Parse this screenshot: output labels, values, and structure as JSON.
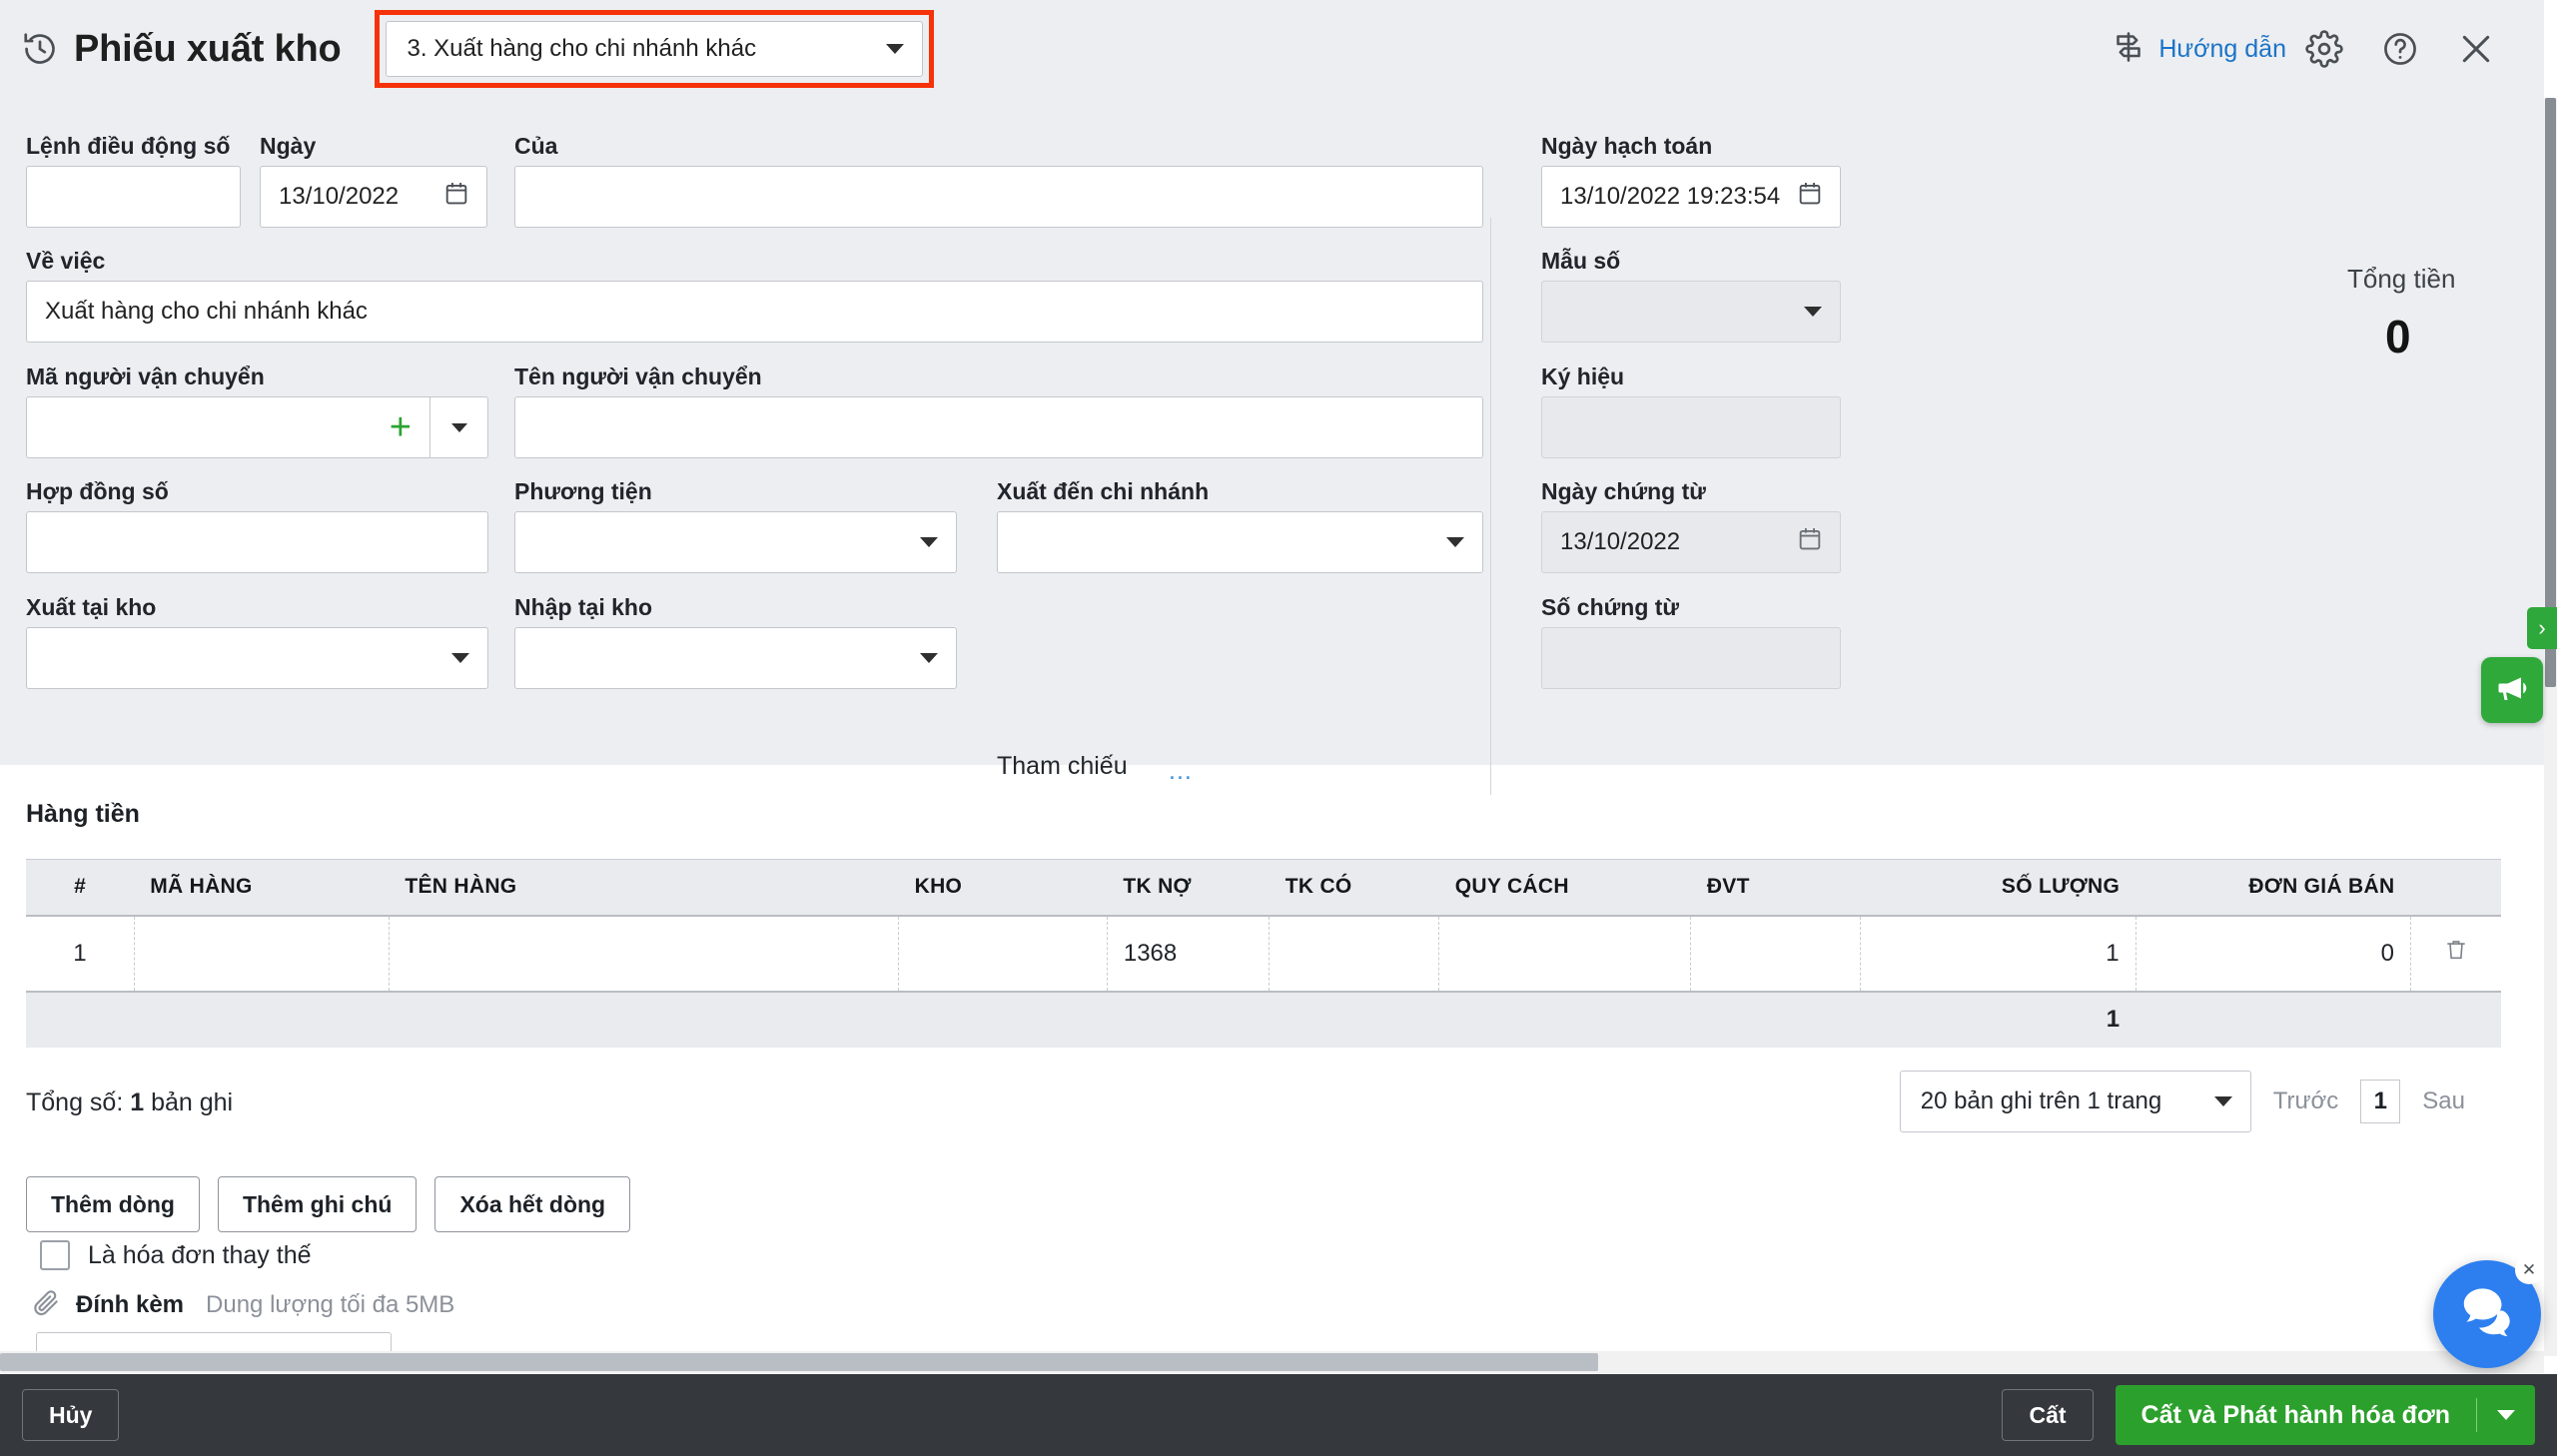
{
  "header": {
    "clock_icon": "clock-history-icon",
    "title": "Phiếu xuất kho",
    "doc_type": "3. Xuất hàng cho chi nhánh khác",
    "guide_icon": "signpost-icon",
    "guide_label": "Hướng dẫn",
    "gear_icon": "gear-icon",
    "help_icon": "question-circle-icon",
    "close_icon": "close-icon",
    "accent_link": "#1a73c8",
    "highlight_box": "#f5320a"
  },
  "form": {
    "lenh_dieu_dong_label": "Lệnh điều động số",
    "lenh_dieu_dong_value": "",
    "ngay_label": "Ngày",
    "ngay_value": "13/10/2022",
    "cua_label": "Của",
    "cua_value": "",
    "ve_viec_label": "Về việc",
    "ve_viec_value": "Xuất hàng cho chi nhánh khác",
    "ma_nguoi_van_chuyen_label": "Mã người vận chuyển",
    "ma_nguoi_van_chuyen_value": "",
    "ten_nguoi_van_chuyen_label": "Tên người vận chuyển",
    "ten_nguoi_van_chuyen_value": "",
    "hop_dong_so_label": "Hợp đồng số",
    "hop_dong_so_value": "",
    "phuong_tien_label": "Phương tiện",
    "phuong_tien_value": "",
    "xuat_den_chi_nhanh_label": "Xuất đến chi nhánh",
    "xuat_den_chi_nhanh_value": "",
    "xuat_tai_kho_label": "Xuất tại kho",
    "xuat_tai_kho_value": "",
    "nhap_tai_kho_label": "Nhập tại kho",
    "nhap_tai_kho_value": "",
    "tham_chieu_label": "Tham chiếu",
    "tham_chieu_dots": "...",
    "ngay_hach_toan_label": "Ngày hạch toán",
    "ngay_hach_toan_value": "13/10/2022 19:23:54",
    "mau_so_label": "Mẫu số",
    "mau_so_value": "",
    "ky_hieu_label": "Ký hiệu",
    "ky_hieu_value": "",
    "ngay_chung_tu_label": "Ngày chứng từ",
    "ngay_chung_tu_value": "13/10/2022",
    "so_chung_tu_label": "Số chứng từ",
    "so_chung_tu_value": "",
    "tong_tien_label": "Tổng tiền",
    "tong_tien_value": "0",
    "add_icon": "plus-icon",
    "calendar_icon": "calendar-icon"
  },
  "table": {
    "section_title": "Hàng tiền",
    "columns": [
      "#",
      "MÃ HÀNG",
      "TÊN HÀNG",
      "KHO",
      "TK NỢ",
      "TK CÓ",
      "QUY CÁCH",
      "ĐVT",
      "SỐ LƯỢNG",
      "ĐƠN GIÁ BÁN",
      ""
    ],
    "rows": [
      {
        "index": "1",
        "ma_hang": "",
        "ten_hang": "",
        "kho": "",
        "tk_no": "1368",
        "tk_co": "",
        "quy_cach": "",
        "dvt": "",
        "so_luong": "1",
        "don_gia_ban": "0",
        "delete_icon": "trash-icon"
      }
    ],
    "summary_so_luong": "1",
    "total_text_prefix": "Tổng số:",
    "total_count": "1",
    "total_text_suffix": "bản ghi"
  },
  "pagination": {
    "page_size": "20 bản ghi trên 1 trang",
    "prev_label": "Trước",
    "current_page": "1",
    "next_label": "Sau"
  },
  "row_actions": {
    "add_row": "Thêm dòng",
    "add_note": "Thêm ghi chú",
    "delete_all": "Xóa hết dòng"
  },
  "options": {
    "replacement_invoice_label": "Là hóa đơn thay thế",
    "replacement_invoice_checked": false,
    "attachment_icon": "paperclip-icon",
    "attachment_label": "Đính kèm",
    "attachment_hint": "Dung lượng tối đa 5MB"
  },
  "bottom_bar": {
    "cancel_label": "Hủy",
    "save_label": "Cất",
    "save_issue_label": "Cất và Phát hành hóa đơn",
    "dropdown_icon": "chevron-down-icon",
    "green": "#2ca02c",
    "bar_bg": "#35383d"
  },
  "floating": {
    "promo_tab_icon": "chevron-right-icon",
    "promo_icon": "megaphone-icon",
    "chat_icon": "chat-bubbles-icon",
    "chat_close_icon": "close-icon",
    "promo_color": "#2fa93a",
    "chat_color": "#2d7ff0"
  }
}
